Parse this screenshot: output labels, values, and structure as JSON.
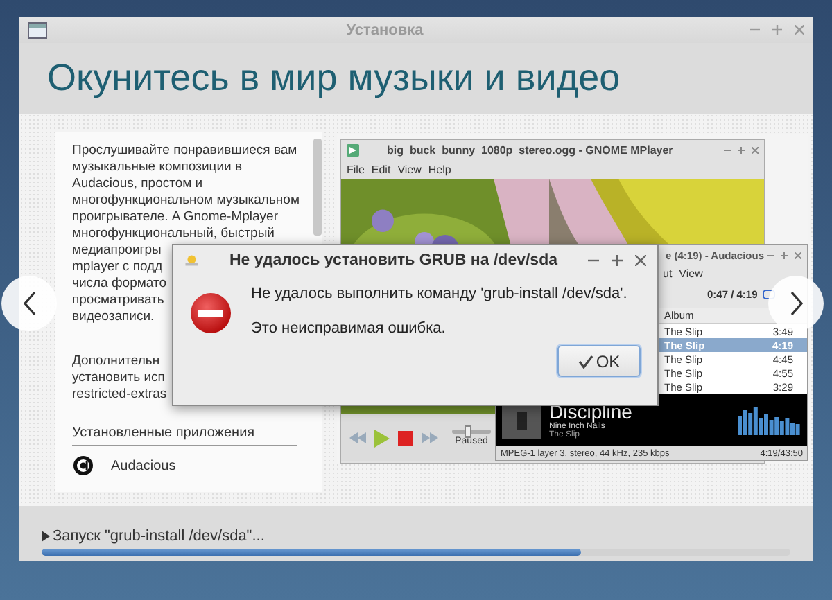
{
  "window": {
    "title": "Установка"
  },
  "heading": "Окунитесь в мир музыки и видео",
  "slide": {
    "paragraph_lines": [
      "Прослушивайте понравившиеся вам",
      "музыкальные композиции в",
      "Audacious, простом и",
      "многофункциональном музыкальном",
      "проигрывателе. A Gnome-Mplayer",
      "многофункциональный, быстрый",
      "медиапроигры",
      "mplayer с подд",
      "числа формато",
      "просматривать",
      "видеозаписи."
    ],
    "extra_lines": [
      "Дополнительн",
      "установить исп",
      "restricted-extras"
    ],
    "installed_heading": "Установленные приложения",
    "installed_apps": [
      {
        "name": "Audacious"
      }
    ],
    "screenshot": {
      "mplayer": {
        "title": "big_buck_bunny_1080p_stereo.ogg - GNOME MPlayer",
        "menu": [
          "File",
          "Edit",
          "View",
          "Help"
        ],
        "seek": {
          "level": 0.4
        },
        "status": "Paused"
      },
      "audacious": {
        "title": "e (4:19) - Audacious",
        "menu": [
          "ut",
          "View"
        ],
        "time": "0:47 / 4:19",
        "column": "Album",
        "rows": [
          {
            "album": "The Slip",
            "length": "3:49",
            "selected": false
          },
          {
            "album": "The Slip",
            "length": "4:19",
            "selected": true
          },
          {
            "album": "The Slip",
            "length": "4:45",
            "selected": false
          },
          {
            "album": "The Slip",
            "length": "4:55",
            "selected": false
          },
          {
            "album": "The Slip",
            "length": "3:29",
            "selected": false
          }
        ],
        "track": "Discipline",
        "artist": "Nine Inch Nails",
        "album": "The Slip",
        "format": "MPEG-1 layer 3, stereo, 44 kHz, 235 kbps",
        "position": "4:19/43:50"
      }
    }
  },
  "dialog": {
    "title": "Не удалось установить GRUB на /dev/sda",
    "message": "Не удалось выполнить команду 'grub-install /dev/sda'.",
    "detail": "Это неисправимая ошибка.",
    "button": "OK"
  },
  "progress": {
    "label": "Запуск \"grub-install /dev/sda\"...",
    "level": 0.72
  }
}
